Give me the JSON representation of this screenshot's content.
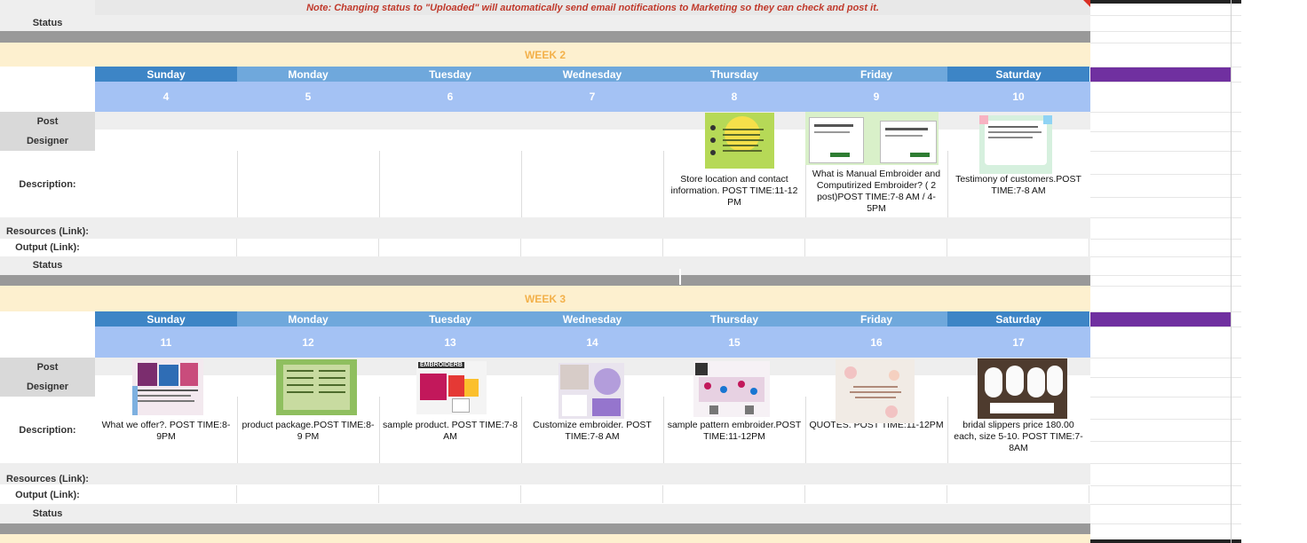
{
  "note": "Note: Changing status to \"Uploaded\" will automatically send email notifications to Marketing so they can check and post it.",
  "labels": {
    "status": "Status",
    "post": "Post",
    "designer": "Designer",
    "description": "Description:",
    "resources": "Resources (Link):",
    "output": "Output (Link):"
  },
  "days": [
    "Sunday",
    "Monday",
    "Tuesday",
    "Wednesday",
    "Thursday",
    "Friday",
    "Saturday"
  ],
  "weeks": [
    {
      "title": "WEEK 2",
      "dates": [
        "4",
        "5",
        "6",
        "7",
        "8",
        "9",
        "10"
      ],
      "descriptions": [
        "",
        "",
        "",
        "",
        "Store location and contact information. POST TIME:11-12 PM",
        "What is Manual Embroider and Computirized Embroider? ( 2 post)POST TIME:7-8 AM / 4-5PM",
        "Testimony of customers.POST TIME:7-8 AM"
      ]
    },
    {
      "title": "WEEK 3",
      "dates": [
        "11",
        "12",
        "13",
        "14",
        "15",
        "16",
        "17"
      ],
      "descriptions": [
        "What we offer?. POST TIME:8-9PM",
        "product package.POST TIME:8-9 PM",
        "sample product. POST TIME:7-8 AM",
        "Customize embroider. POST TIME:7-8 AM",
        "sample pattern embroider.POST TIME:11-12PM",
        "QUOTES. POST TIME:11-12PM",
        "bridal slippers price 180.00 each, size 5-10. POST TIME:7-8AM"
      ]
    }
  ],
  "thumb_text": {
    "embroider_logo": "EMBROIDERB"
  },
  "colors": {
    "day_dark": "#3d85c6",
    "day_light": "#6fa8dc",
    "date_row": "#a4c2f4",
    "week_band": "#fdf0cf",
    "week_text": "#f3b14b",
    "note_text": "#c0392b",
    "purple": "#7030a0"
  }
}
